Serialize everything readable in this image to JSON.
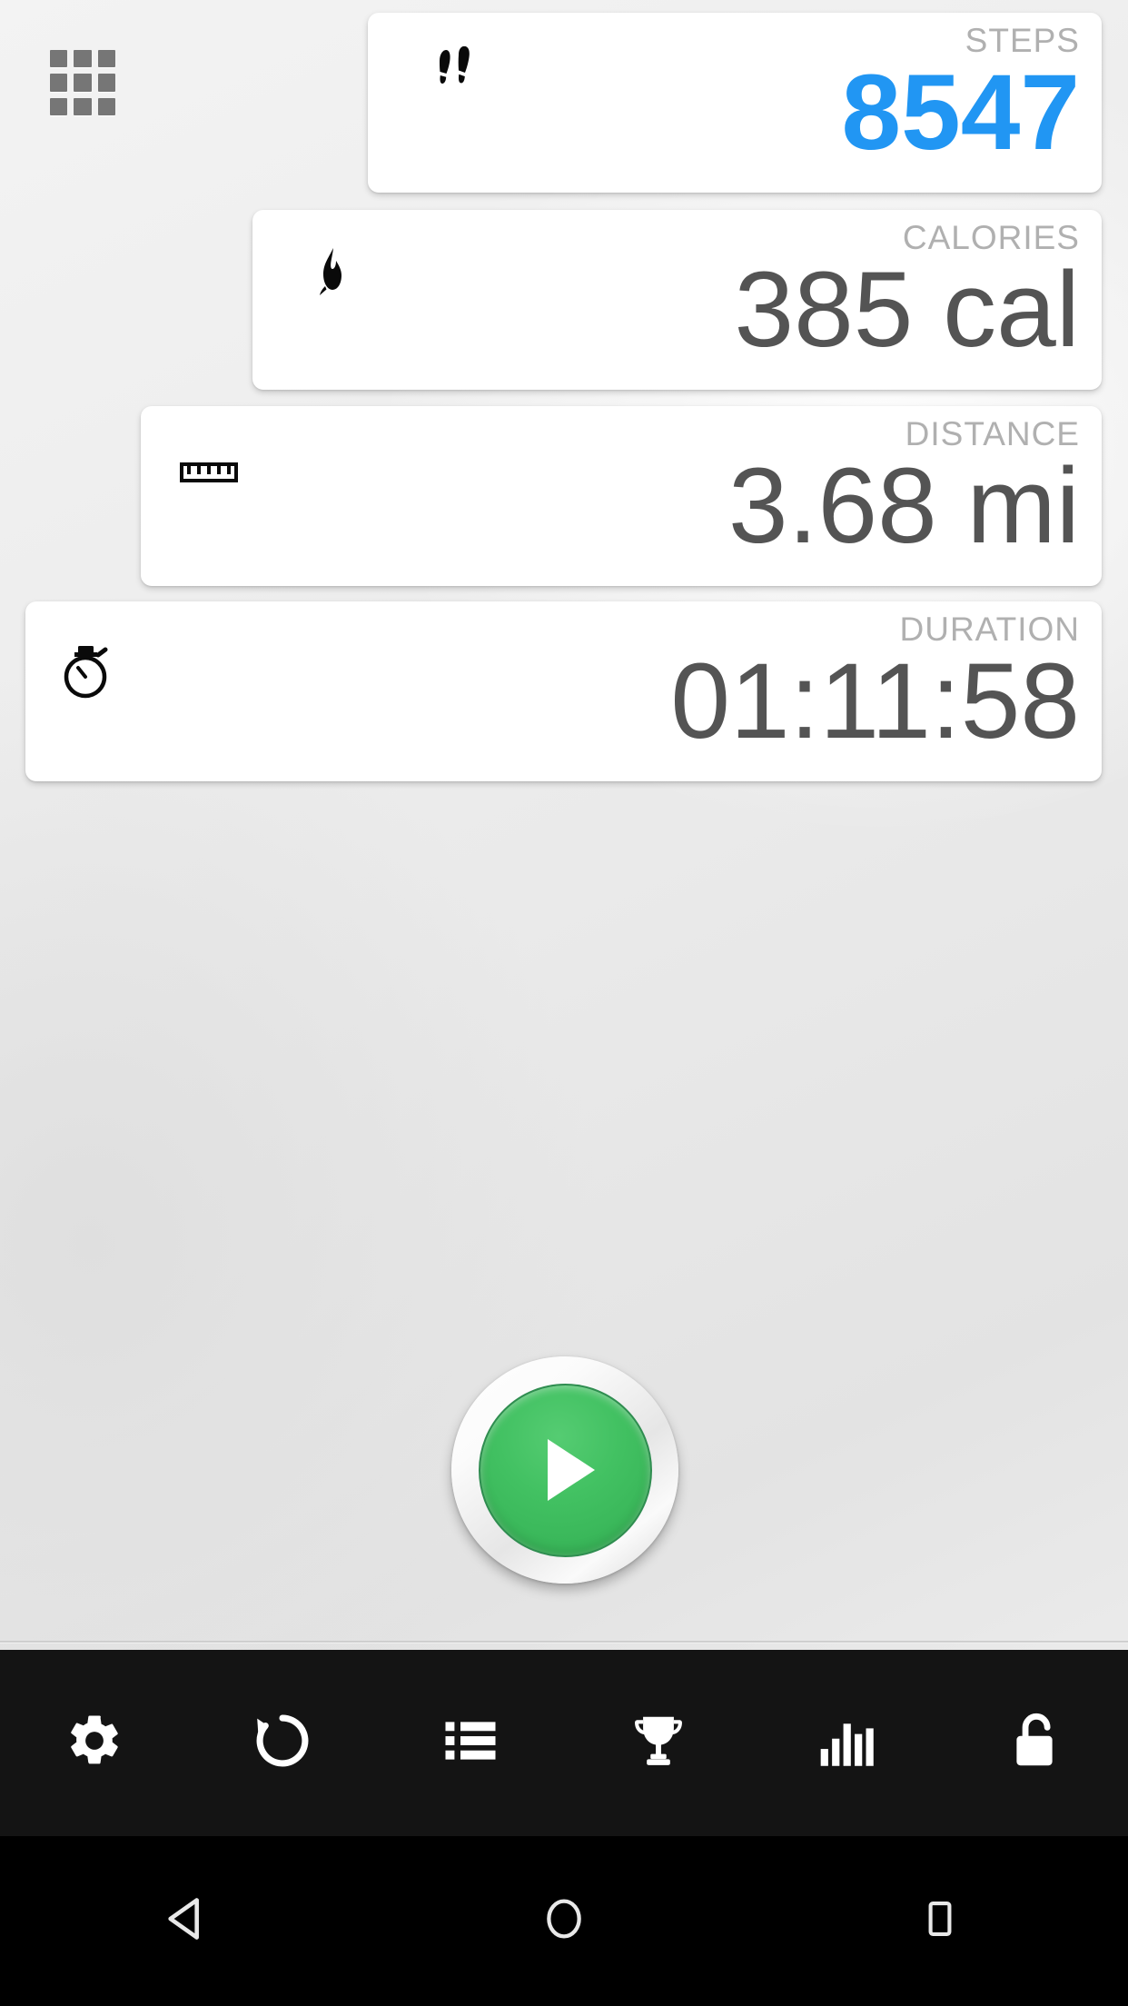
{
  "app": {
    "background_color": "#eceded",
    "accent_color": "#2196F3",
    "value_color": "#545454",
    "label_color": "#b0b0b0",
    "play_button_color": "#3ebd5d",
    "toolbar_color": "#141414",
    "nav_bar_color": "#000000"
  },
  "header": {
    "apps_grid_icon": "apps-grid-icon"
  },
  "cards": [
    {
      "id": "steps",
      "label": "STEPS",
      "value": "8547",
      "icon": "footprints-icon",
      "accent": true
    },
    {
      "id": "calories",
      "label": "CALORIES",
      "value": "385 cal",
      "icon": "flame-icon",
      "accent": false
    },
    {
      "id": "distance",
      "label": "DISTANCE",
      "value": "3.68 mi",
      "icon": "ruler-icon",
      "accent": false
    },
    {
      "id": "duration",
      "label": "DURATION",
      "value": "01:11:58",
      "icon": "stopwatch-icon",
      "accent": false
    }
  ],
  "play_button": {
    "icon": "play-icon",
    "state": "stopped"
  },
  "toolbar": {
    "items": [
      {
        "id": "settings",
        "icon": "gear-icon"
      },
      {
        "id": "reset",
        "icon": "reset-arrow-icon"
      },
      {
        "id": "history",
        "icon": "list-icon"
      },
      {
        "id": "achievements",
        "icon": "trophy-icon"
      },
      {
        "id": "statistics",
        "icon": "bar-chart-icon"
      },
      {
        "id": "lock",
        "icon": "unlock-icon"
      }
    ]
  },
  "nav_bar": {
    "items": [
      {
        "id": "back",
        "icon": "back-triangle-icon"
      },
      {
        "id": "home",
        "icon": "home-circle-icon"
      },
      {
        "id": "recents",
        "icon": "recents-square-icon"
      }
    ]
  }
}
